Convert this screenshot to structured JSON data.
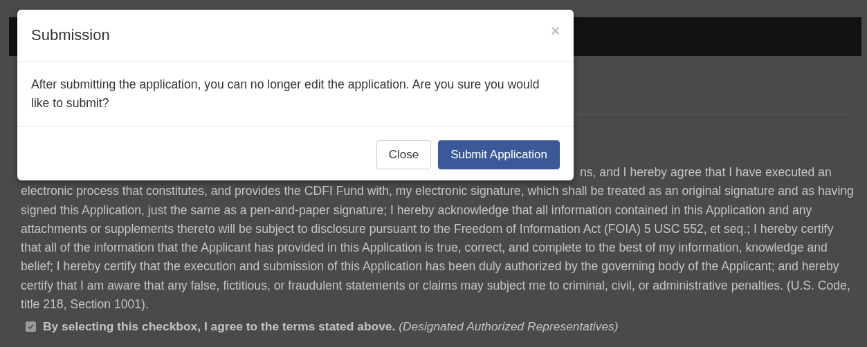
{
  "modal": {
    "title": "Submission",
    "close_label": "×",
    "message": "After submitting the application, you can no longer edit the application. Are you sure you would like to submit?",
    "buttons": [
      {
        "label": "Close",
        "kind": "default"
      },
      {
        "label": "Submit Application",
        "kind": "primary"
      }
    ]
  },
  "page": {
    "certification_text": "ns, and I hereby agree that I have executed an electronic process that constitutes, and provides the CDFI Fund with, my electronic signature, which shall be treated as an original signature and as having signed this Application, just the same as a pen-and-paper signature; I hereby acknowledge that all information contained in this Application and any attachments or supplements thereto will be subject to disclosure pursuant to the Freedom of Information Act (FOIA) 5 USC 552, et seq.; I hereby certify that all of the information that the Applicant has provided in this Application is true, correct, and complete to the best of my information, knowledge and belief; I hereby certify that the execution and submission of this Application has been duly authorized by the governing body of the Applicant; and hereby certify that I am aware that any false, fictitious, or fraudulent statements or claims may subject me to criminal, civil, or administrative penalties. (U.S. Code, title 218, Section 1001).",
    "agreement": {
      "checked": true,
      "label": "**By selecting this checkbox, I agree to the terms stated above.** *(Designated Authorized Representatives)*"
    }
  }
}
